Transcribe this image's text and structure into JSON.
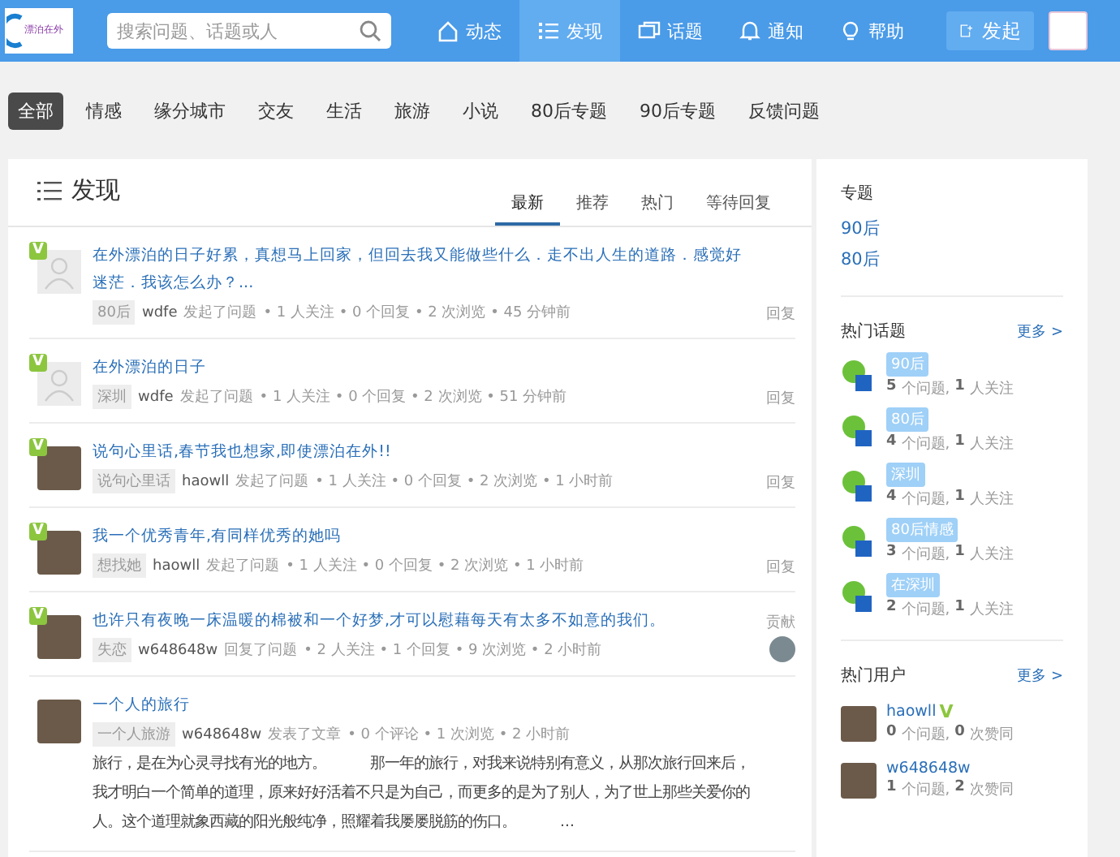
{
  "header": {
    "logo_text": "漂泊在外",
    "search": {
      "placeholder": "搜索问题、话题或人"
    },
    "nav": [
      {
        "label": "动态",
        "selected": false
      },
      {
        "label": "发现",
        "selected": true
      },
      {
        "label": "话题",
        "selected": false
      },
      {
        "label": "通知",
        "selected": false
      },
      {
        "label": "帮助",
        "selected": false
      }
    ],
    "post_button": "发起"
  },
  "categories": [
    {
      "label": "全部",
      "selected": true
    },
    {
      "label": "情感",
      "selected": false
    },
    {
      "label": "缘分城市",
      "selected": false
    },
    {
      "label": "交友",
      "selected": false
    },
    {
      "label": "生活",
      "selected": false
    },
    {
      "label": "旅游",
      "selected": false
    },
    {
      "label": "小说",
      "selected": false
    },
    {
      "label": "80后专题",
      "selected": false
    },
    {
      "label": "90后专题",
      "selected": false
    },
    {
      "label": "反馈问题",
      "selected": false
    }
  ],
  "main": {
    "title": "发现",
    "tabs": [
      {
        "label": "最新",
        "selected": true
      },
      {
        "label": "推荐",
        "selected": false
      },
      {
        "label": "热门",
        "selected": false
      },
      {
        "label": "等待回复",
        "selected": false
      }
    ],
    "items": [
      {
        "badge": "V",
        "kind": "default",
        "title": "在外漂泊的日子好累，真想马上回家，但回去我又能做些什么．走不出人生的道路．感觉好迷茫．我该怎么办？...",
        "tag": "80后",
        "author": "wdfe",
        "action": "发起了问题",
        "stats": "• 1 人关注 • 0 个回复 • 2 次浏览 • 45 分钟前",
        "side": {
          "kind": "reply",
          "label": "回复"
        }
      },
      {
        "badge": "V",
        "kind": "default",
        "title": "在外漂泊的日子",
        "tag": "深圳",
        "author": "wdfe",
        "action": "发起了问题",
        "stats": "• 1 人关注 • 0 个回复 • 2 次浏览 • 51 分钟前",
        "side": {
          "kind": "reply",
          "label": "回复"
        }
      },
      {
        "badge": "V",
        "kind": "photo",
        "title": "说句心里话,春节我也想家,即使漂泊在外!!",
        "tag": "说句心里话",
        "author": "haowll",
        "action": "发起了问题",
        "stats": "• 1 人关注 • 0 个回复 • 2 次浏览 • 1 小时前",
        "side": {
          "kind": "reply",
          "label": "回复"
        }
      },
      {
        "badge": "V",
        "kind": "photo",
        "title": "我一个优秀青年,有同样优秀的她吗",
        "tag": "想找她",
        "author": "haowll",
        "action": "发起了问题",
        "stats": "• 1 人关注 • 0 个回复 • 2 次浏览 • 1 小时前",
        "side": {
          "kind": "reply",
          "label": "回复"
        }
      },
      {
        "badge": "V",
        "kind": "photo",
        "title": "也许只有夜晚一床温暖的棉被和一个好梦,才可以慰藉每天有太多不如意的我们。",
        "tag": "失恋",
        "author": "w648648w",
        "action": "回复了问题",
        "stats": "• 2 人关注 • 1 个回复 • 9 次浏览 • 2 小时前",
        "side": {
          "kind": "contributor",
          "label": "贡献"
        }
      },
      {
        "kind": "photo",
        "title": "一个人的旅行",
        "tag": "一个人旅游",
        "author": "w648648w",
        "action": "发表了文章",
        "stats": "• 0 个评论 • 1 次浏览 • 2 小时前",
        "body": "旅行，是在为心灵寻找有光的地方。　　　那一年的旅行，对我来说特别有意义，从那次旅行回来后，我才明白一个简单的道理，原来好好活着不只是为自己，而更多的是为了别人，为了世上那些关爱你的人。这个道理就象西藏的阳光般纯净，照耀着我屡屡脱筋的伤口。　　　..."
      }
    ]
  },
  "sidebar": {
    "topics_title": "专题",
    "topics": [
      "90后",
      "80后"
    ],
    "hot_topics": {
      "title": "热门话题",
      "more": "更多 >",
      "items": [
        {
          "name": "90后",
          "count": "5",
          "count_label": "个问题,",
          "follow": "1",
          "follow_label": "人关注"
        },
        {
          "name": "80后",
          "count": "4",
          "count_label": "个问题,",
          "follow": "1",
          "follow_label": "人关注"
        },
        {
          "name": "深圳",
          "count": "4",
          "count_label": "个问题,",
          "follow": "1",
          "follow_label": "人关注"
        },
        {
          "name": "80后情感",
          "count": "3",
          "count_label": "个问题,",
          "follow": "1",
          "follow_label": "人关注"
        },
        {
          "name": "在深圳",
          "count": "2",
          "count_label": "个问题,",
          "follow": "1",
          "follow_label": "人关注"
        }
      ]
    },
    "hot_users": {
      "title": "热门用户",
      "more": "更多 >",
      "items": [
        {
          "name": "haowll",
          "badge": "V",
          "q": "0",
          "q_label": "个问题,",
          "a": "0",
          "a_label": "次赞同"
        },
        {
          "name": "w648648w",
          "q": "1",
          "q_label": "个问题,",
          "a": "2",
          "a_label": "次赞同"
        }
      ]
    }
  }
}
